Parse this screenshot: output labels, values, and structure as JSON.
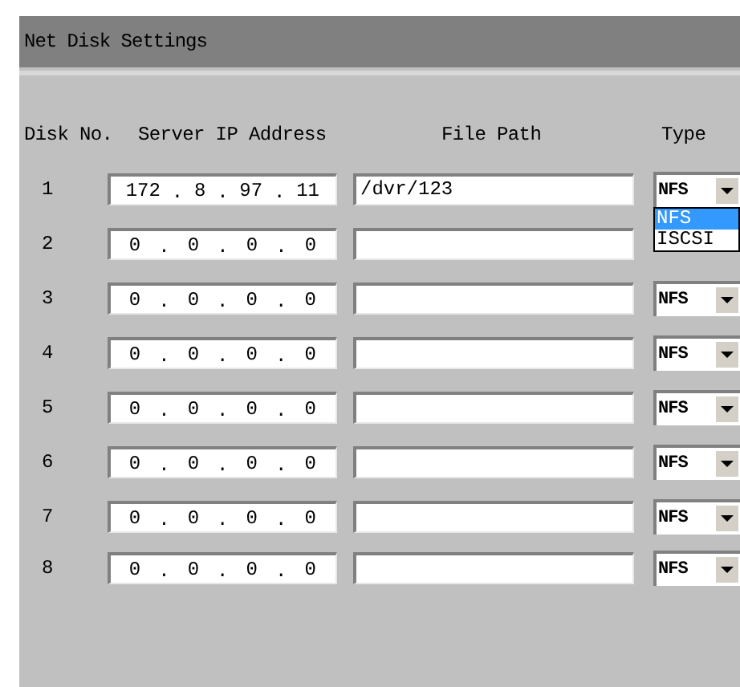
{
  "title": "Net Disk Settings",
  "columns": [
    "Disk No.",
    "Server IP Address",
    "File Path",
    "Type"
  ],
  "ip_separator": ".",
  "rows": [
    {
      "number": "1",
      "ip_octets": [
        "172",
        "8",
        "97",
        "11"
      ],
      "path": "/dvr/123",
      "type": "NFS",
      "dropdown": [
        {
          "label": "NFS",
          "selected": true
        },
        {
          "label": "ISCSI",
          "selected": false
        }
      ]
    },
    {
      "number": "2",
      "ip_octets": [
        "0",
        "0",
        "0",
        "0"
      ]
    },
    {
      "number": "3",
      "ip_octets": [
        "0",
        "0",
        "0",
        "0"
      ],
      "type": "NFS"
    },
    {
      "number": "4",
      "ip_octets": [
        "0",
        "0",
        "0",
        "0"
      ],
      "type": "NFS"
    },
    {
      "number": "5",
      "ip_octets": [
        "0",
        "0",
        "0",
        "0"
      ],
      "type": "NFS"
    },
    {
      "number": "6",
      "ip_octets": [
        "0",
        "0",
        "0",
        "0"
      ],
      "type": "NFS"
    },
    {
      "number": "7",
      "ip_octets": [
        "0",
        "0",
        "0",
        "0"
      ],
      "type": "NFS"
    },
    {
      "number": "8",
      "ip_octets": [
        "0",
        "0",
        "0",
        "0"
      ],
      "type": "NFS"
    }
  ]
}
